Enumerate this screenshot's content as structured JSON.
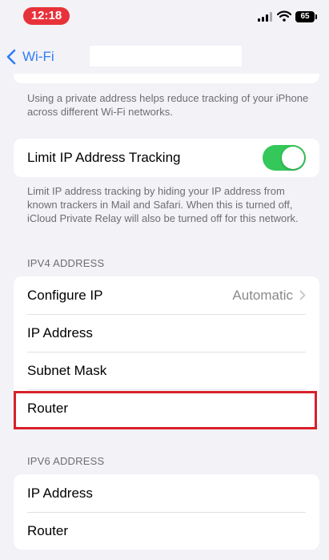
{
  "status_bar": {
    "time": "12:18",
    "battery": "65"
  },
  "nav": {
    "back_label": "Wi-Fi"
  },
  "private_address_footnote": "Using a private address helps reduce tracking of your iPhone across different Wi-Fi networks.",
  "limit_tracking": {
    "label": "Limit IP Address Tracking",
    "enabled": true,
    "footnote": "Limit IP address tracking by hiding your IP address from known trackers in Mail and Safari. When this is turned off, iCloud Private Relay will also be turned off for this network."
  },
  "ipv4": {
    "header": "IPV4 ADDRESS",
    "rows": [
      {
        "label": "Configure IP",
        "value": "Automatic"
      },
      {
        "label": "IP Address"
      },
      {
        "label": "Subnet Mask"
      },
      {
        "label": "Router"
      }
    ]
  },
  "ipv6": {
    "header": "IPV6 ADDRESS",
    "rows": [
      {
        "label": "IP Address"
      },
      {
        "label": "Router"
      }
    ]
  },
  "colors": {
    "accent": "#2f7cf6",
    "toggle_on": "#34c759",
    "highlight": "#d8202b",
    "time_pill": "#e8323a"
  },
  "icons": [
    "back-chevron-icon",
    "signal-icon",
    "wifi-icon",
    "battery-icon",
    "chevron-right-icon"
  ]
}
